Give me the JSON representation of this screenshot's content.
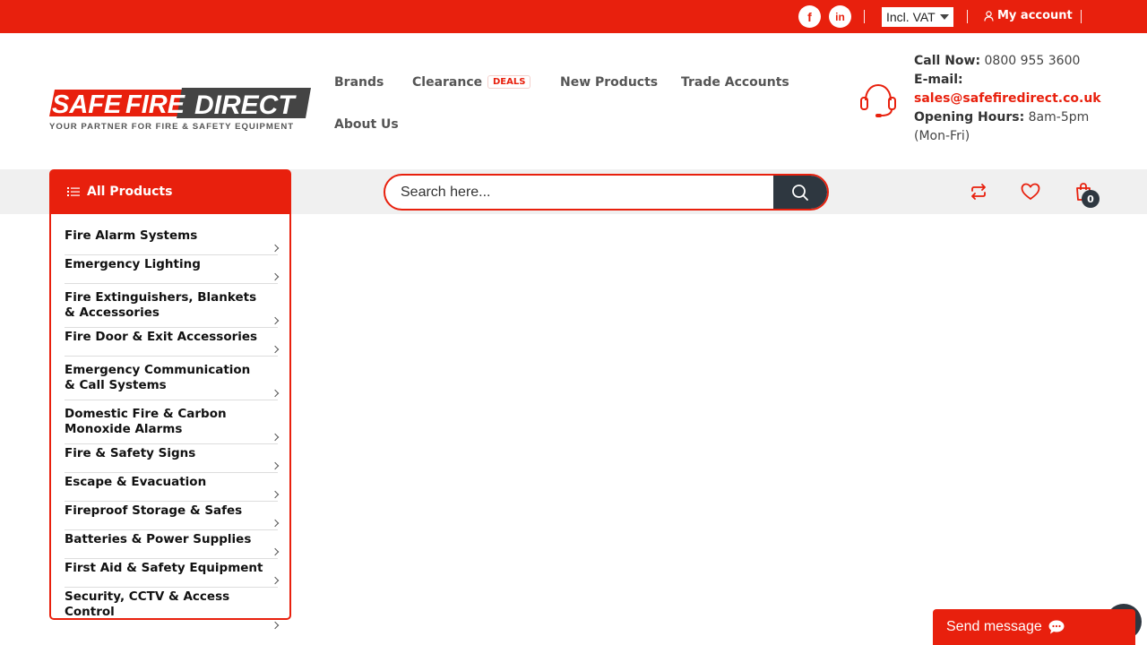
{
  "topbar": {
    "facebook": "f",
    "linkedin": "in",
    "vat_selected": "Incl. VAT",
    "account_label": "My account"
  },
  "logo": {
    "text_safe": "SAFE",
    "text_fire": "FIRE",
    "text_direct": "DIRECT",
    "tagline": "YOUR PARTNER FOR FIRE & SAFETY EQUIPMENT"
  },
  "nav": {
    "brands": "Brands",
    "clearance": "Clearance",
    "deals_badge": "DEALS",
    "new_products": "New Products",
    "trade_accounts": "Trade Accounts",
    "about_us": "About Us"
  },
  "contact": {
    "call_label": "Call Now:",
    "phone": "0800 955 3600",
    "email_label": "E-mail:",
    "email": "sales@safefiredirect.co.uk",
    "hours_label": "Opening Hours:",
    "hours": "8am-5pm",
    "days": "(Mon-Fri)"
  },
  "all_products": "All Products",
  "search": {
    "placeholder": "Search here..."
  },
  "cart_count": "0",
  "categories": [
    "Fire Alarm Systems",
    "Emergency Lighting",
    "Fire Extinguishers, Blankets & Accessories",
    "Fire Door & Exit Accessories",
    "Emergency Communication & Call Systems",
    "Domestic Fire & Carbon Monoxide Alarms",
    "Fire & Safety Signs",
    "Escape & Evacuation",
    "Fireproof Storage & Safes",
    "Batteries & Power Supplies",
    "First Aid & Safety Equipment",
    "Security, CCTV & Access Control"
  ],
  "chat": {
    "label": "Send message"
  },
  "colors": {
    "brand_red": "#e8200d",
    "dark": "#2e3740"
  },
  "icons": [
    "facebook-icon",
    "linkedin-icon",
    "user-icon",
    "headset-icon",
    "list-icon",
    "search-icon",
    "compare-icon",
    "heart-icon",
    "bag-icon",
    "chat-icon"
  ]
}
